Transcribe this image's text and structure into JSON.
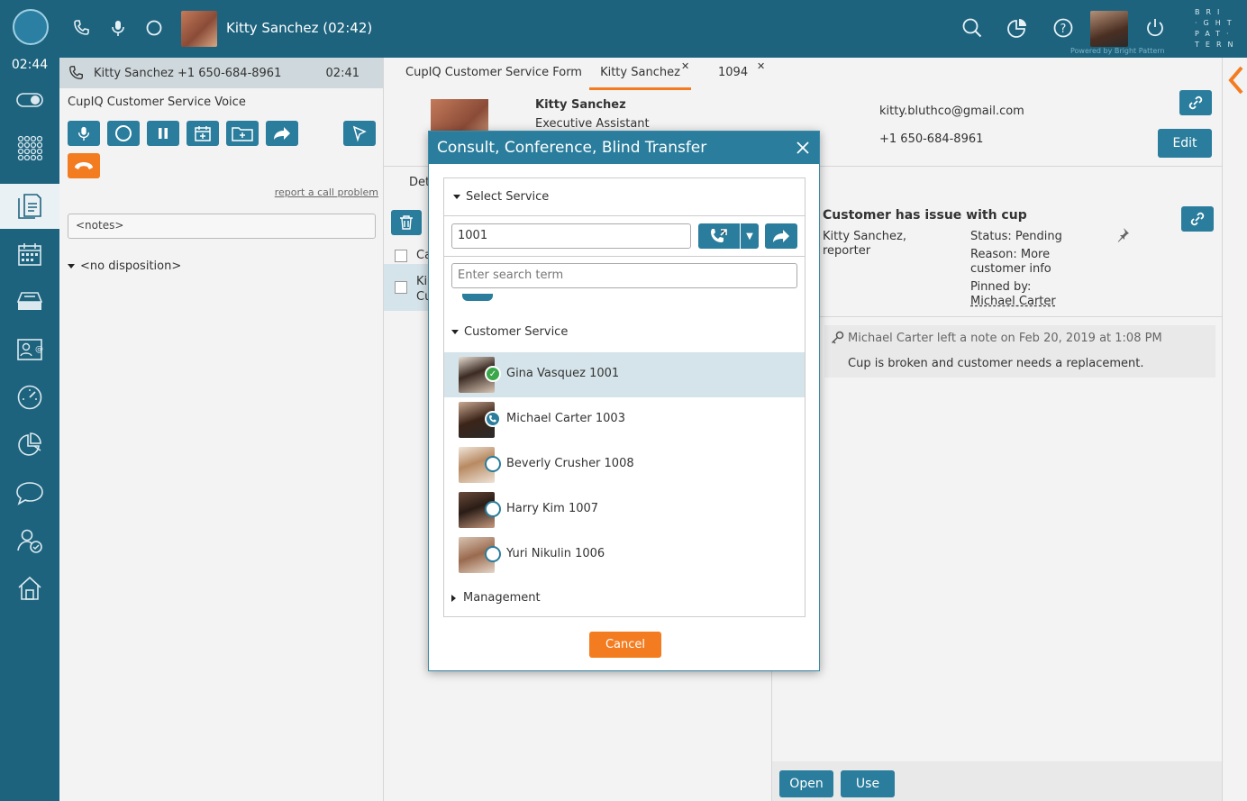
{
  "topbar": {
    "caller_name": "Kitty Sanchez",
    "call_timer": "(02:42)",
    "brand_lines": [
      "BRI",
      "·GHT",
      "PAT·",
      "TERN"
    ],
    "powered_by": "Powered by Bright Pattern"
  },
  "sidebar": {
    "time": "02:44"
  },
  "interaction": {
    "header_caller": "Kitty Sanchez +1 650-684-8961",
    "header_time": "02:41",
    "service_name": "CupIQ Customer Service Voice",
    "report_link": "report a call problem",
    "notes_placeholder": "<notes>",
    "disposition": "<no disposition>"
  },
  "tabs": [
    {
      "label": "CupIQ Customer Service Form"
    },
    {
      "label": "Kitty Sanchez"
    },
    {
      "label": "1094"
    }
  ],
  "contact": {
    "name": "Kitty Sanchez",
    "title": "Executive Assistant",
    "email": "kitty.bluthco@gmail.com",
    "phone": "+1 650-684-8961",
    "edit_label": "Edit"
  },
  "list": {
    "details_label": "Det",
    "row1_text": "Ca",
    "row2_line1": "Ki",
    "row2_line2": "Cu"
  },
  "case": {
    "title": "Customer has issue with cup",
    "reporter": "Kitty Sanchez,",
    "reporter_role": "reporter",
    "status": "Status: Pending",
    "reason_line1": "Reason: More",
    "reason_line2": "customer info",
    "pinned_label": "Pinned by:",
    "pinned_by": "Michael Carter",
    "note_meta": "Michael Carter left a note on Feb 20, 2019 at 1:08 PM",
    "note_text": "Cup is broken and customer needs a replacement.",
    "open_label": "Open",
    "use_label": "Use"
  },
  "modal": {
    "title": "Consult, Conference, Blind Transfer",
    "select_service": "Select Service",
    "number_value": "1001",
    "search_placeholder": "Enter search term",
    "group_customer_service": "Customer Service",
    "group_management": "Management",
    "agents": [
      {
        "name": "Gina Vasquez 1001",
        "status": "available"
      },
      {
        "name": "Michael Carter 1003",
        "status": "on-call"
      },
      {
        "name": "Beverly Crusher 1008",
        "status": "offline"
      },
      {
        "name": "Harry Kim 1007",
        "status": "offline"
      },
      {
        "name": "Yuri Nikulin 1006",
        "status": "offline"
      }
    ],
    "cancel_label": "Cancel"
  },
  "colors": {
    "brand": "#1d637e",
    "button": "#2a7d9c",
    "accent": "#f47c20",
    "available": "#3aa84a"
  }
}
